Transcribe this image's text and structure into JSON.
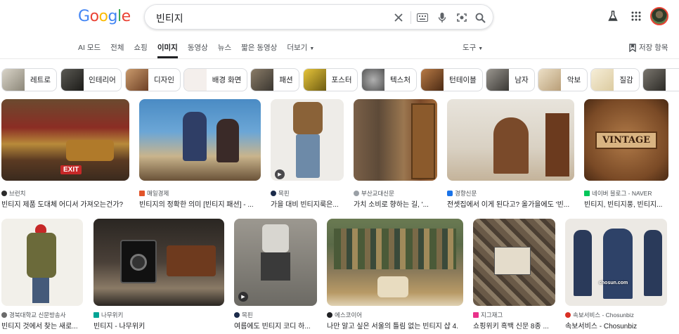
{
  "search": {
    "query": "빈티지"
  },
  "logo": {
    "text": "Google"
  },
  "tabs": [
    {
      "label": "AI 모드",
      "active": false
    },
    {
      "label": "전체",
      "active": false
    },
    {
      "label": "쇼핑",
      "active": false
    },
    {
      "label": "이미지",
      "active": true
    },
    {
      "label": "동영상",
      "active": false
    },
    {
      "label": "뉴스",
      "active": false
    },
    {
      "label": "짧은 동영상",
      "active": false
    },
    {
      "label": "더보기",
      "active": false
    }
  ],
  "tools_label": "도구",
  "saved_label": "저장 항목",
  "chips": [
    {
      "label": "레트로",
      "color": "#b8b2a6"
    },
    {
      "label": "인테리어",
      "color": "#3b3a36"
    },
    {
      "label": "디자인",
      "color": "#9a6a4a"
    },
    {
      "label": "배경 화면",
      "color": "#f3efec"
    },
    {
      "label": "패션",
      "color": "#6b6256"
    },
    {
      "label": "포스터",
      "color": "#d2b02a"
    },
    {
      "label": "텍스처",
      "color": "#8c8c8c"
    },
    {
      "label": "턴테이블",
      "color": "#7a4e2c"
    },
    {
      "label": "남자",
      "color": "#5d5a55"
    },
    {
      "label": "악보",
      "color": "#d7c7aa"
    },
    {
      "label": "질감",
      "color": "#eee3c7"
    },
    {
      "label": "",
      "color": "#55524c"
    }
  ],
  "results": [
    {
      "source": "브런치",
      "title": "빈티지 제품 도대체 어디서 가져오는건가?",
      "fav": "#2b2b2b",
      "video": false
    },
    {
      "source": "매일경제",
      "title": "빈티지의 정확한 의미 [빈티지 패션] - ...",
      "fav": "#e2542a",
      "video": false
    },
    {
      "source": "목핀",
      "title": "가을 대비 빈티지룩은...",
      "fav": "#1b2b4a",
      "video": true
    },
    {
      "source": "부산교대신문",
      "title": "가치 소비로 향하는 길, '...",
      "fav": "#9aa0a6",
      "video": false
    },
    {
      "source": "경향신문",
      "title": "전셋집에서 이게 된다고? 올가을에도 '빈...",
      "fav": "#1a73e8",
      "video": false
    },
    {
      "source": "네이버 블로그 - NAVER",
      "title": "빈티지, 빈티지풍, 빈티지...",
      "fav": "#03c75a",
      "video": false
    },
    {
      "source": "경북대학교 신문방송사",
      "title": "빈티지 것에서 찾는 새로...",
      "fav": "#6b6b6b",
      "video": false
    },
    {
      "source": "나무위키",
      "title": "빈티지 - 나무위키",
      "fav": "#00a495",
      "video": false
    },
    {
      "source": "목핀",
      "title": "여름에도 빈티지 코디 하...",
      "fav": "#1b2b4a",
      "video": true
    },
    {
      "source": "에스코이어",
      "title": "나만 알고 싶은 서울의 틀림 없는 빈티지 샵 4.",
      "fav": "#202124",
      "video": false
    },
    {
      "source": "지그재그",
      "title": "쇼핑위키 흑백 신문 8종 ...",
      "fav": "#e9318a",
      "video": false
    },
    {
      "source": "속보서비스 - Chosunbiz",
      "title": "속보서비스 - Chosunbiz",
      "fav": "#d93025",
      "video": false
    }
  ],
  "image_texts": {
    "exit_sign": "EXIT",
    "vintage_sign": "VINTAGE",
    "watermark": "chosun.com"
  }
}
